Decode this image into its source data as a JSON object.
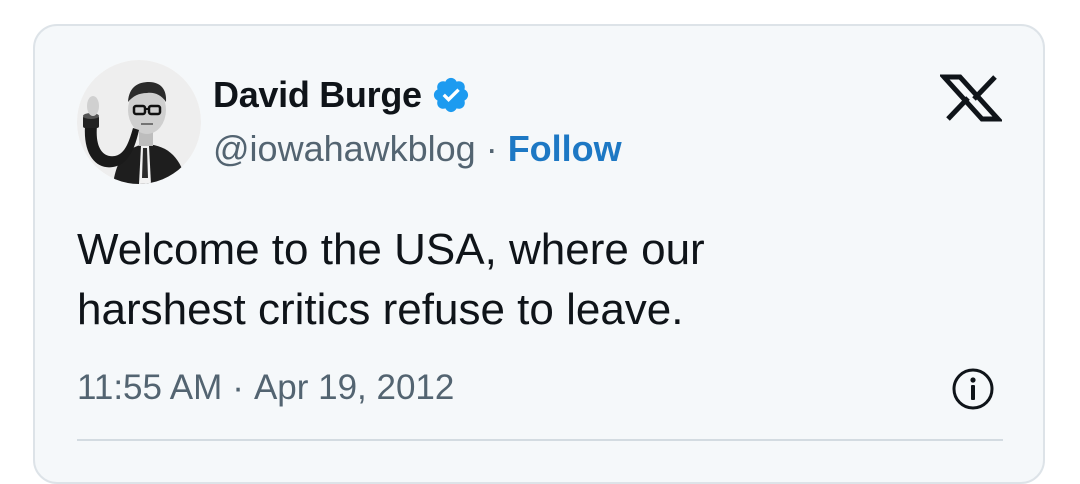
{
  "tweet": {
    "author": {
      "display_name": "David Burge",
      "handle": "@iowahawkblog",
      "verified": true
    },
    "follow_label": "Follow",
    "separator": "·",
    "text_lines": [
      "Welcome to the USA, where our",
      "harshest critics refuse to leave."
    ],
    "time": "11:55 AM",
    "date": "Apr 19, 2012"
  },
  "icons": {
    "platform_logo": "x-logo-icon",
    "verified": "verified-badge-icon",
    "info": "info-icon"
  },
  "colors": {
    "card_background": "#f5f8fa",
    "text_primary": "#0f1419",
    "text_secondary": "#536471",
    "link_blue": "#1d78c4",
    "verified_blue": "#1d9bf0"
  }
}
